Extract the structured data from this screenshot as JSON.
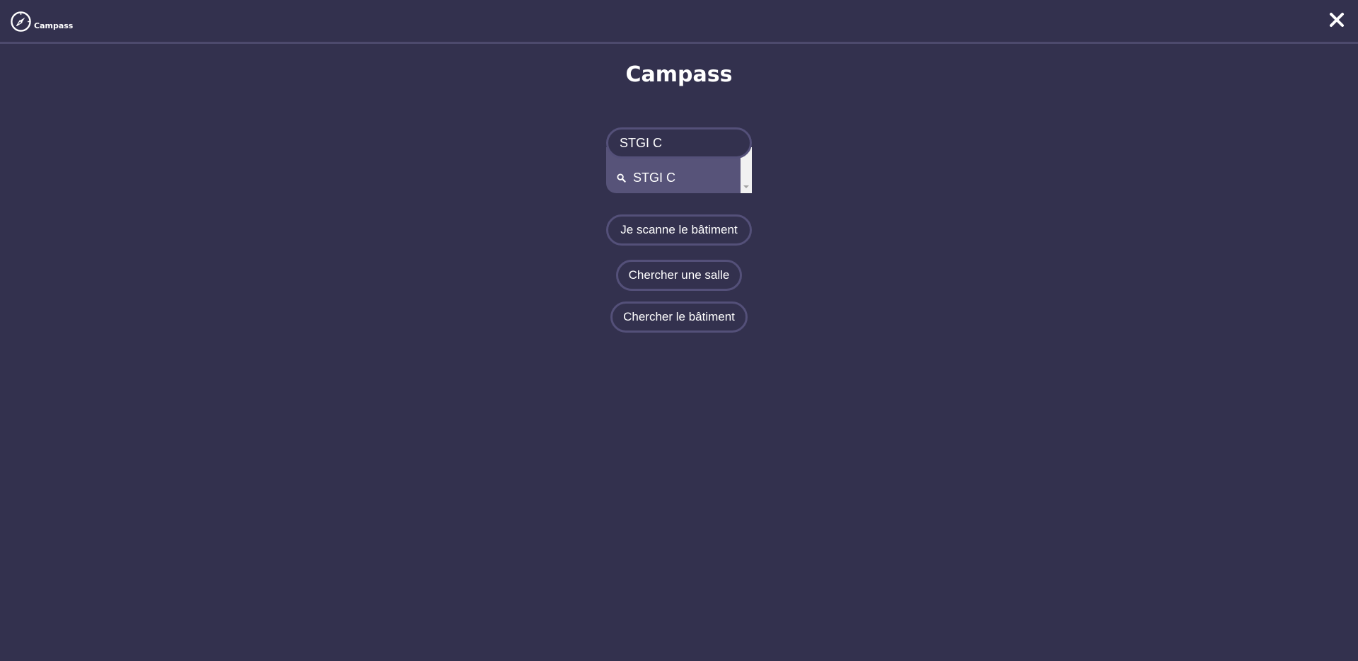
{
  "app": {
    "brand_name": "Campass",
    "logo_icon": "compass-icon",
    "close_icon": "close-icon"
  },
  "main": {
    "title": "Campass"
  },
  "search": {
    "value": "STGI C",
    "suggestions": [
      {
        "icon": "search-icon",
        "label": "STGI C"
      }
    ]
  },
  "actions": {
    "scan_building": "Je scanne le bâtiment",
    "search_room": "Chercher une salle",
    "search_building": "Chercher le bâtiment"
  },
  "colors": {
    "background": "#33314e",
    "border": "#545079",
    "suggestion_bg": "#575379",
    "text": "#ffffff"
  }
}
